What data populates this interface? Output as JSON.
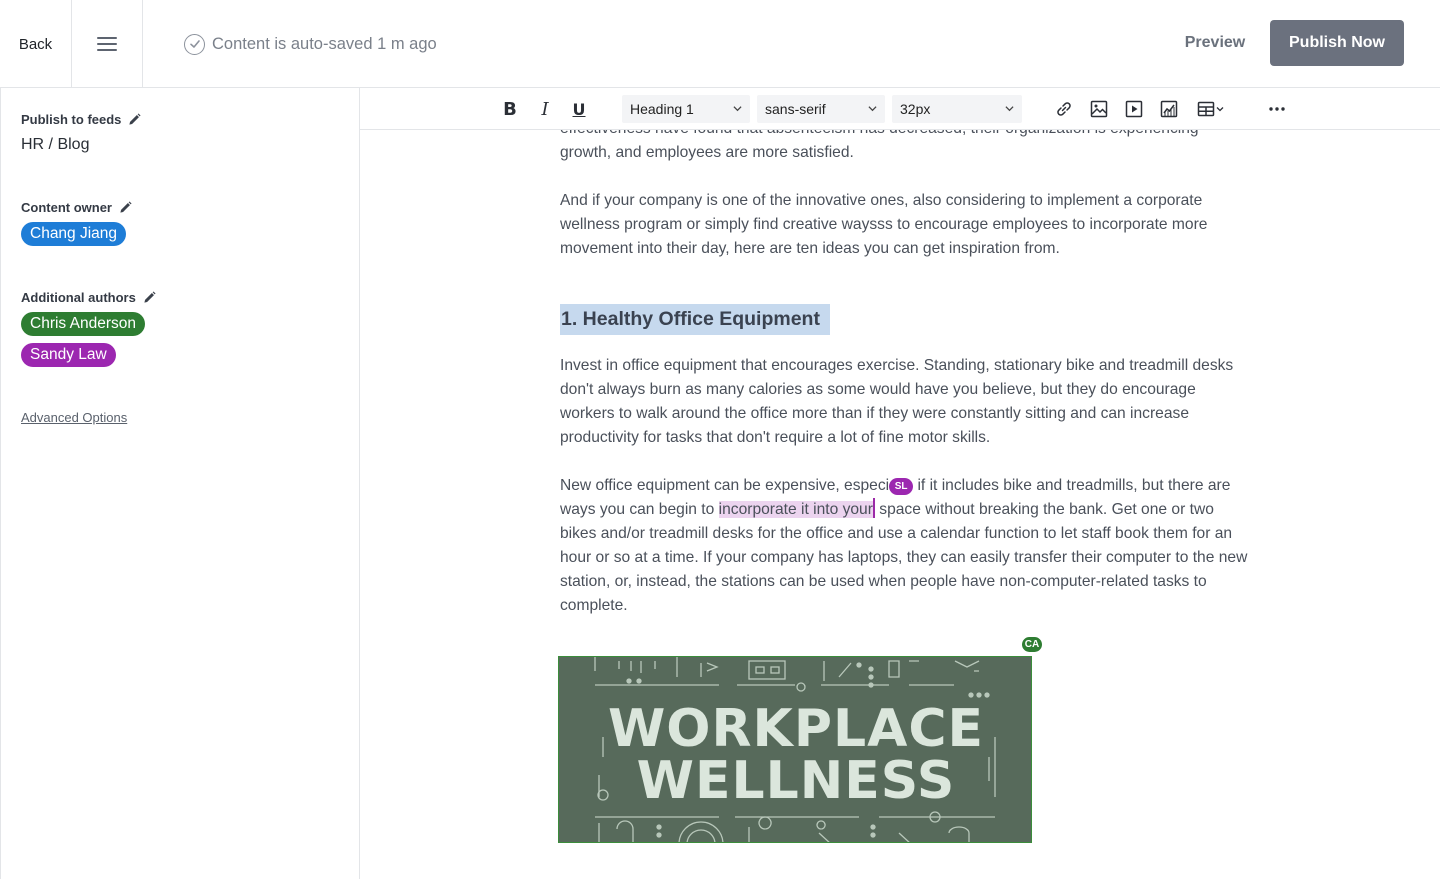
{
  "header": {
    "back_label": "Back",
    "autosave_text": "Content is auto-saved 1 m ago",
    "preview_label": "Preview",
    "publish_label": "Publish Now"
  },
  "sidebar": {
    "feeds_label": "Publish to feeds",
    "feeds_value": "HR / Blog",
    "owner_label": "Content owner",
    "owner": {
      "name": "Chang Jiang",
      "color": "#1e7dd7"
    },
    "authors_label": "Additional authors",
    "authors": [
      {
        "name": "Chris Anderson",
        "color": "#2e7d32"
      },
      {
        "name": "Sandy Law",
        "color": "#9c27b0"
      }
    ],
    "advanced_label": "Advanced Options"
  },
  "toolbar": {
    "bold": "B",
    "italic": "I",
    "underline": "U",
    "block_style": "Heading 1",
    "font_family": "sans-serif",
    "font_size": "32px",
    "icons": [
      "link-icon",
      "image-icon",
      "video-icon",
      "chart-icon",
      "table-icon",
      "more-icon"
    ]
  },
  "content": {
    "para_top": "effectiveness have found that absenteeism has decreased, their organization is experiencing growth, and employees are more satisfied.",
    "para_intro": "And if your company is one of the innovative ones, also considering to implement a corporate wellness program or simply find creative waysss to encourage employees to incorporate more movement into their day, here are ten ideas you can get inspiration from.",
    "heading": "1. Healthy Office Equipment",
    "para_1": "Invest in office equipment that encourages exercise. Standing, stationary bike and treadmill desks don't always burn as many calories as some would have you believe, but they do encourage workers to walk around the office more than if they were constantly sitting and can increase productivity for tasks that don't require a lot of fine motor skills.",
    "para_2_a": "New office equipment can be expensive, especi",
    "para_2_b": " if it includes bike and treadmills, but there are ways you can begin to ",
    "para_2_selected": "incorporate it into your",
    "para_2_c": " space without breaking the bank. Get one or two bikes and/or treadmill desks for the office and use a calendar function to let staff book them for an hour or so at a time. If your company has laptops, they can easily transfer their computer to the new station, or, instead, the stations can be used when people have non-computer-related tasks to complete.",
    "cursor_sl": "SL",
    "cursor_ca": "CA",
    "image_title_1": "WORKPLACE",
    "image_title_2": "WELLNESS"
  }
}
